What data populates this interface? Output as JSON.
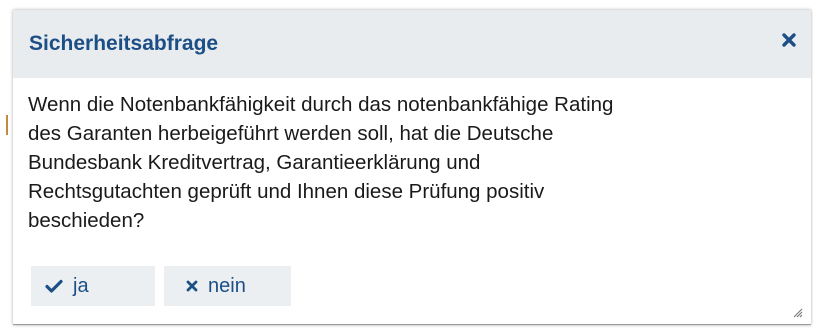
{
  "dialog": {
    "title": "Sicherheitsabfrage",
    "close_icon": "close-icon",
    "message": "Wenn die Notenbankfähigkeit durch das notenbankfähige Rating\ndes Garanten herbeigeführt werden soll, hat die Deutsche\nBundesbank Kreditvertrag, Garantieerklärung und\nRechtsgutachten geprüft und Ihnen diese Prüfung positiv\nbeschieden?",
    "yes_button": {
      "label": "ja",
      "icon": "checkmark-icon"
    },
    "no_button": {
      "label": "nein",
      "icon": "close-icon"
    }
  },
  "colors": {
    "accent": "#1c4f86",
    "titlebar_bg": "#e9ecef",
    "button_bg": "#eceff2"
  }
}
